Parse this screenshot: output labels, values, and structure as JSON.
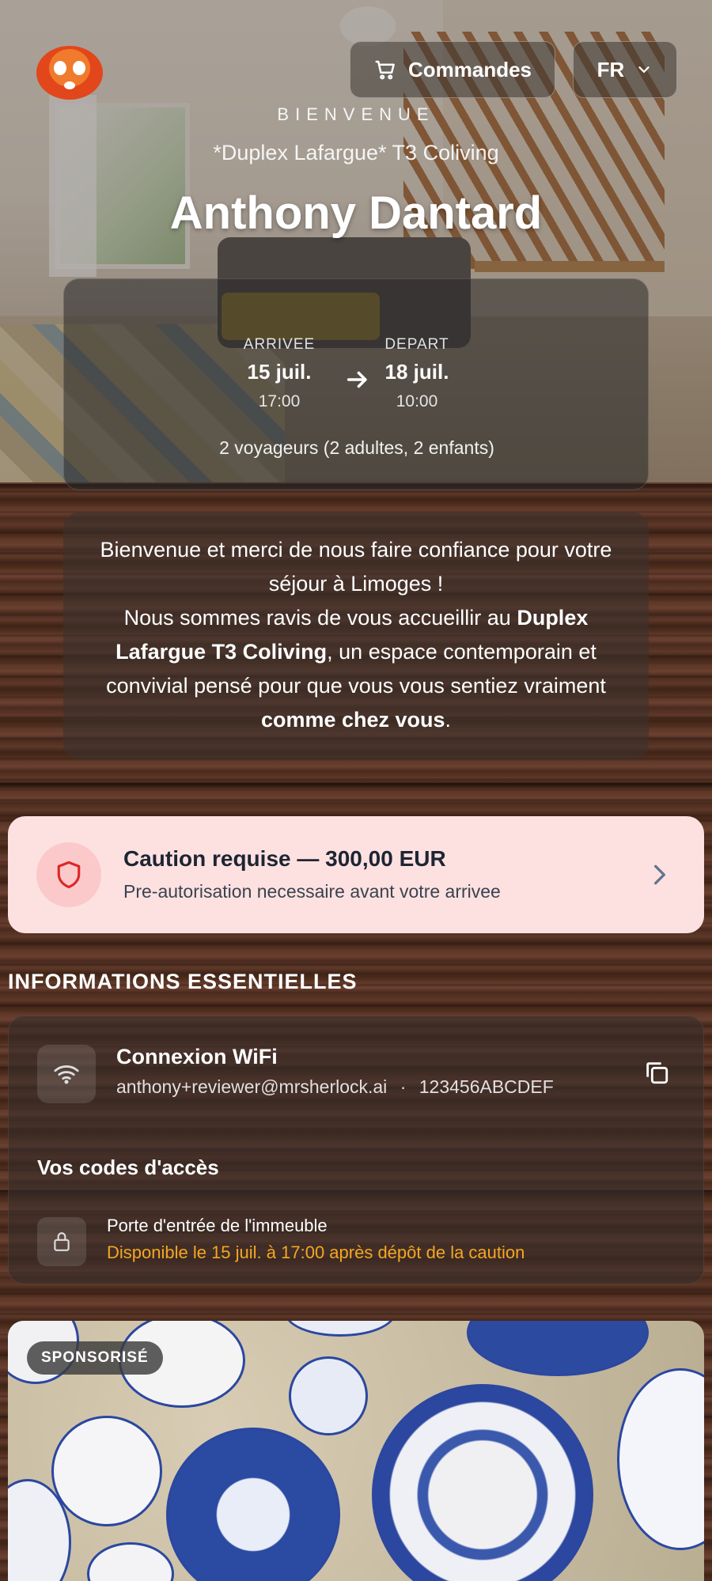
{
  "header": {
    "orders_label": "Commandes",
    "language": "FR"
  },
  "welcome": {
    "kicker": "BIENVENUE",
    "property": "*Duplex Lafargue* T3 Coliving",
    "guest_name": "Anthony Dantard"
  },
  "stay": {
    "arrival_label": "ARRIVEE",
    "arrival_date": "15 juil.",
    "arrival_time": "17:00",
    "departure_label": "DEPART",
    "departure_date": "18 juil.",
    "departure_time": "10:00",
    "guests": "2 voyageurs  (2 adultes, 2 enfants)"
  },
  "intro": {
    "line1": "Bienvenue et merci de nous faire confiance pour votre séjour à Limoges !",
    "line2_pre": "Nous sommes ravis de vous accueillir au ",
    "line2_bold": "Duplex Lafargue T3 Coliving",
    "line2_mid": ", un espace contemporain et convivial pensé pour que vous vous sentiez vraiment ",
    "line2_bold2": "comme chez vous",
    "line2_end": "."
  },
  "deposit": {
    "title": "Caution requise — 300,00 EUR",
    "subtitle": "Pre-autorisation necessaire avant votre arrivee"
  },
  "essentials": {
    "section_title": "INFORMATIONS ESSENTIELLES",
    "wifi_title": "Connexion WiFi",
    "wifi_network": "anthony+reviewer@mrsherlock.ai",
    "wifi_separator": "·",
    "wifi_password": "123456ABCDEF",
    "codes_title": "Vos codes d'accès",
    "code_label": "Porte d'entrée de l'immeuble",
    "code_status": "Disponible le 15 juil. à 17:00 après dépôt de la caution"
  },
  "ad": {
    "badge": "SPONSORISÉ"
  },
  "colors": {
    "deposit_bg": "#fde1e1",
    "deposit_accent": "#dc2626",
    "warning_text": "#f5a623"
  }
}
